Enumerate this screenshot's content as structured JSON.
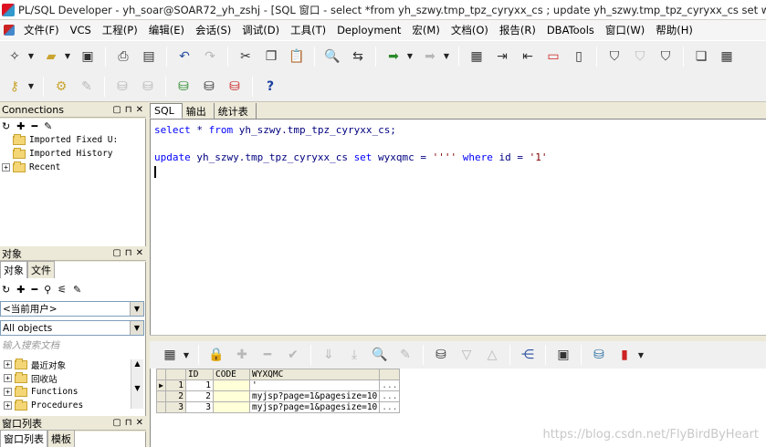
{
  "window": {
    "title": "PL/SQL Developer - yh_soar@SOAR72_yh_zshj - [SQL 窗口 - select *from yh_szwy.tmp_tpz_cyryxx_cs ; update yh_szwy.tmp_tpz_cyryxx_cs set wyxqmc=\"'' where"
  },
  "menu": [
    "文件(F)",
    "VCS",
    "工程(P)",
    "编辑(E)",
    "会话(S)",
    "调试(D)",
    "工具(T)",
    "Deployment",
    "宏(M)",
    "文档(O)",
    "报告(R)",
    "DBATools",
    "窗口(W)",
    "帮助(H)"
  ],
  "connections": {
    "title": "Connections",
    "items": [
      "Imported Fixed U:",
      "Imported History",
      "Recent"
    ]
  },
  "objects": {
    "title": "对象",
    "tabs": [
      "对象",
      "文件"
    ],
    "user_combo": "<当前用户>",
    "type_combo": "All objects",
    "search_placeholder": "输入搜索文档",
    "items": [
      "最近对象",
      "回收站",
      "Functions",
      "Procedures"
    ]
  },
  "window_list": {
    "title": "窗口列表",
    "tabs": [
      "窗口列表",
      "模板"
    ]
  },
  "editor": {
    "tabs": [
      "SQL",
      "输出",
      "统计表"
    ],
    "line1": {
      "kw1": "select",
      "rest1": " * ",
      "kw2": "from",
      "rest2": " yh_szwy.tmp_tpz_cyryxx_cs;"
    },
    "line2": {
      "kw1": "update",
      "rest1": " yh_szwy.tmp_tpz_cyryxx_cs ",
      "kw2": "set",
      "rest2": " wyxqmc = ",
      "str1": "''''",
      "sp": " ",
      "kw3": "where",
      "rest3": " id = ",
      "str2": "'1'"
    }
  },
  "grid": {
    "columns": [
      "",
      "",
      "ID",
      "CODE",
      "WYXQMC",
      ""
    ],
    "rows": [
      {
        "indicator": "▶",
        "row": "1",
        "id": "1",
        "code": "",
        "wyxqmc": "'",
        "dots": "..."
      },
      {
        "indicator": "",
        "row": "2",
        "id": "2",
        "code": "",
        "wyxqmc": "myjsp?page=1&pagesize=10",
        "dots": "..."
      },
      {
        "indicator": "",
        "row": "3",
        "id": "3",
        "code": "",
        "wyxqmc": "myjsp?page=1&pagesize=10",
        "dots": "..."
      }
    ]
  },
  "watermark": "https://blog.csdn.net/FlyBirdByHeart"
}
